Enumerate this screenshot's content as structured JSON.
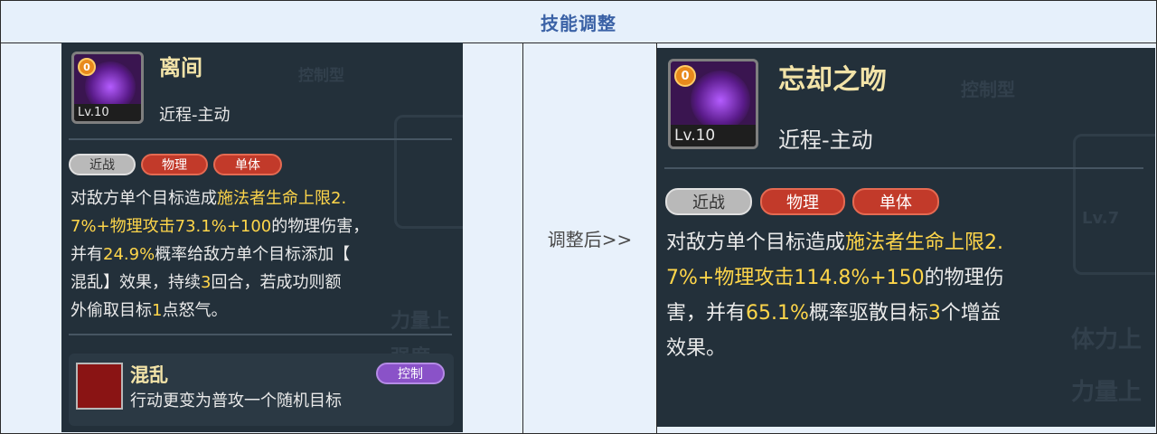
{
  "header": {
    "title": "技能调整"
  },
  "arrow_label": "调整后>>",
  "before": {
    "badge": "0",
    "level": "Lv.10",
    "name": "离间",
    "type": "近程-主动",
    "tags": [
      "近战",
      "物理",
      "单体"
    ],
    "desc_lines": [
      [
        {
          "t": "对敌方单个目标造成"
        },
        {
          "t": "施法者生命上限2.",
          "h": true
        }
      ],
      [
        {
          "t": "7%+物理攻击73.1%+100",
          "h": true
        },
        {
          "t": "的物理伤害，"
        }
      ],
      [
        {
          "t": "并有"
        },
        {
          "t": "24.9%",
          "h": true
        },
        {
          "t": "概率给敌方单个目标添加【"
        }
      ],
      [
        {
          "t": "混乱】效果，持续"
        },
        {
          "t": "3",
          "h": true
        },
        {
          "t": "回合，若成功则额"
        }
      ],
      [
        {
          "t": "外偷取目标"
        },
        {
          "t": "1",
          "h": true
        },
        {
          "t": "点怒气。"
        }
      ]
    ],
    "status": {
      "name": "混乱",
      "tag": "控制",
      "text": "行动更变为普攻一个随机目标"
    },
    "bg_text": [
      "控制型",
      "力量上",
      "强度"
    ]
  },
  "after": {
    "badge": "0",
    "level": "Lv.10",
    "name": "忘却之吻",
    "type": "近程-主动",
    "tags": [
      "近战",
      "物理",
      "单体"
    ],
    "desc_lines": [
      [
        {
          "t": "对敌方单个目标造成"
        },
        {
          "t": "施法者生命上限2.",
          "h": true
        }
      ],
      [
        {
          "t": "7%+物理攻击114.8%+150",
          "h": true
        },
        {
          "t": "的物理伤"
        }
      ],
      [
        {
          "t": "害，并有"
        },
        {
          "t": "65.1%",
          "h": true
        },
        {
          "t": "概率驱散目标"
        },
        {
          "t": "3",
          "h": true
        },
        {
          "t": "个增益"
        }
      ],
      [
        {
          "t": "效果。"
        }
      ]
    ],
    "bg_text": [
      "控制型",
      "Lv.7",
      "体力上",
      "力量上"
    ]
  },
  "colors": {
    "highlight": "#ffd64a",
    "header_text": "#3b62a6",
    "tag_red": "#c23a2a"
  }
}
